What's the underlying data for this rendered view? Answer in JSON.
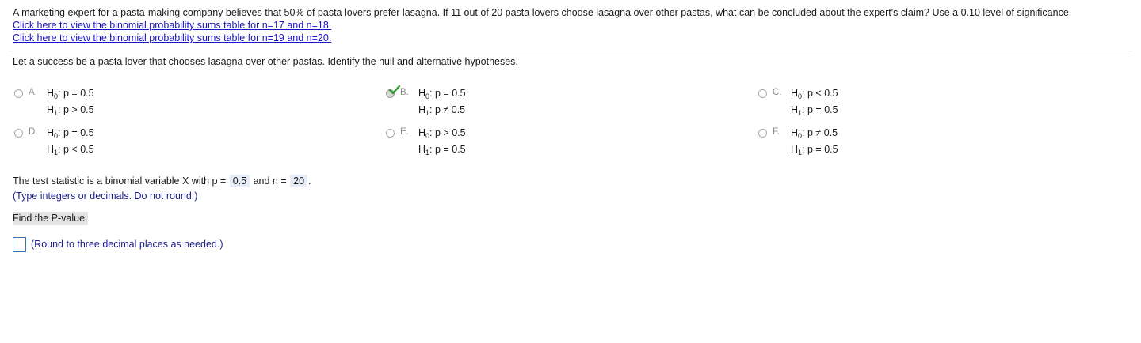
{
  "question": "A marketing expert for a pasta-making company believes that 50% of pasta lovers prefer lasagna. If 11 out of 20 pasta lovers choose lasagna over other pastas, what can be concluded about the expert's claim? Use a 0.10 level of significance.",
  "links": [
    "Click here to view the binomial probability sums table for n=17 and n=18.",
    "Click here to view the binomial probability sums table for n=19 and n=20."
  ],
  "prompt": "Let a success be a pasta lover that chooses lasagna over other pastas. Identify the null and alternative hypotheses.",
  "options": [
    {
      "letter": "A.",
      "h0": "p = 0.5",
      "h1": "p > 0.5",
      "selected": false
    },
    {
      "letter": "B.",
      "h0": "p = 0.5",
      "h1": "p ≠ 0.5",
      "selected": true
    },
    {
      "letter": "C.",
      "h0": "p < 0.5",
      "h1": "p = 0.5",
      "selected": false
    },
    {
      "letter": "D.",
      "h0": "p = 0.5",
      "h1": "p < 0.5",
      "selected": false
    },
    {
      "letter": "E.",
      "h0": "p > 0.5",
      "h1": "p = 0.5",
      "selected": false
    },
    {
      "letter": "F.",
      "h0": "p ≠ 0.5",
      "h1": "p = 0.5",
      "selected": false
    }
  ],
  "hypothesis_labels": {
    "h0_H": "H",
    "h0_sub": "0",
    "h1_H": "H",
    "h1_sub": "1"
  },
  "test_stat": {
    "prefix": "The test statistic is a binomial variable X with p =",
    "p": "0.5",
    "middle": "and n =",
    "n": "20",
    "suffix": "."
  },
  "hint_integers": "(Type integers or decimals. Do not round.)",
  "find_pvalue": "Find the P-value.",
  "pvalue_input": "",
  "hint_round": "(Round to three decimal places as needed.)",
  "colors": {
    "link": "#1515c8",
    "hint": "#1c1c8c",
    "check": "#2e9a2e",
    "answer_bg": "#e6edf8"
  }
}
